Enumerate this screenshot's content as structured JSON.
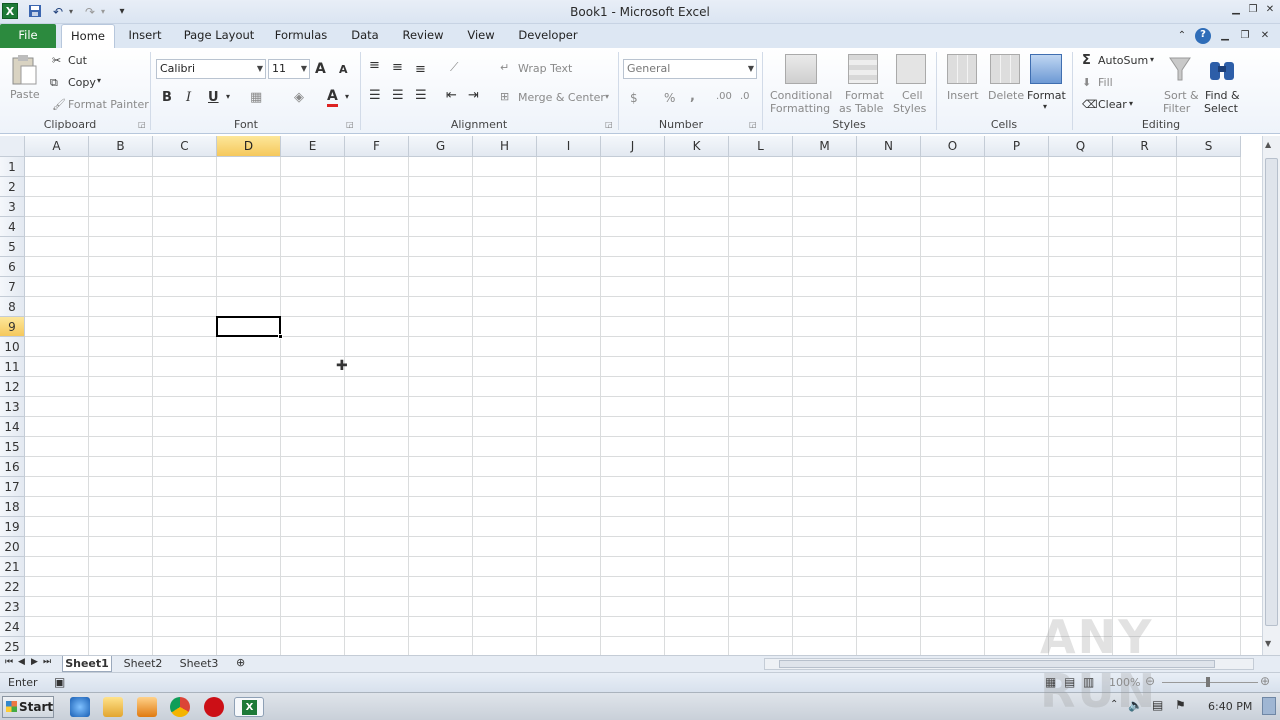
{
  "window": {
    "title": "Book1 - Microsoft Excel"
  },
  "tabs": [
    "File",
    "Home",
    "Insert",
    "Page Layout",
    "Formulas",
    "Data",
    "Review",
    "View",
    "Developer"
  ],
  "ribbon": {
    "clipboard": {
      "paste": "Paste",
      "cut": "Cut",
      "copy": "Copy",
      "format_painter": "Format Painter",
      "label": "Clipboard"
    },
    "font": {
      "name": "Calibri",
      "size": "11",
      "label": "Font",
      "bold": "B",
      "italic": "I",
      "underline": "U",
      "grow": "A",
      "shrink": "A"
    },
    "alignment": {
      "wrap": "Wrap Text",
      "merge": "Merge & Center",
      "label": "Alignment"
    },
    "number": {
      "format": "General",
      "currency": "$",
      "percent": "%",
      "comma": ",",
      "label": "Number",
      "inc_dec": ".00",
      "dec_dec": ".0"
    },
    "styles": {
      "conditional": "Conditional",
      "conditional2": "Formatting",
      "format_table": "Format",
      "format_table2": "as Table",
      "cell_styles": "Cell",
      "cell_styles2": "Styles",
      "label": "Styles"
    },
    "cells": {
      "insert": "Insert",
      "delete": "Delete",
      "format": "Format",
      "label": "Cells"
    },
    "editing": {
      "autosum": "AutoSum",
      "fill": "Fill",
      "clear": "Clear",
      "sort": "Sort &",
      "sort2": "Filter",
      "find": "Find &",
      "find2": "Select",
      "label": "Editing"
    }
  },
  "grid": {
    "columns": [
      "A",
      "B",
      "C",
      "D",
      "E",
      "F",
      "G",
      "H",
      "I",
      "J",
      "K",
      "L",
      "M",
      "N",
      "O",
      "P",
      "Q",
      "R",
      "S"
    ],
    "rows": [
      "1",
      "2",
      "3",
      "4",
      "5",
      "6",
      "7",
      "8",
      "9",
      "10",
      "11",
      "12",
      "13",
      "14",
      "15",
      "16",
      "17",
      "18",
      "19",
      "20",
      "21",
      "22",
      "23",
      "24",
      "25"
    ],
    "selected_column": "D",
    "selected_row": "9"
  },
  "sheets": [
    "Sheet1",
    "Sheet2",
    "Sheet3"
  ],
  "status": {
    "mode": "Enter",
    "zoom": "100%"
  },
  "taskbar": {
    "start": "Start",
    "clock": "6:40 PM"
  },
  "watermark": "ANY RUN",
  "colors": {
    "file_tab": "#2c8a3e",
    "selected_header": "#f5c85c",
    "gridline": "#dadcdd"
  }
}
